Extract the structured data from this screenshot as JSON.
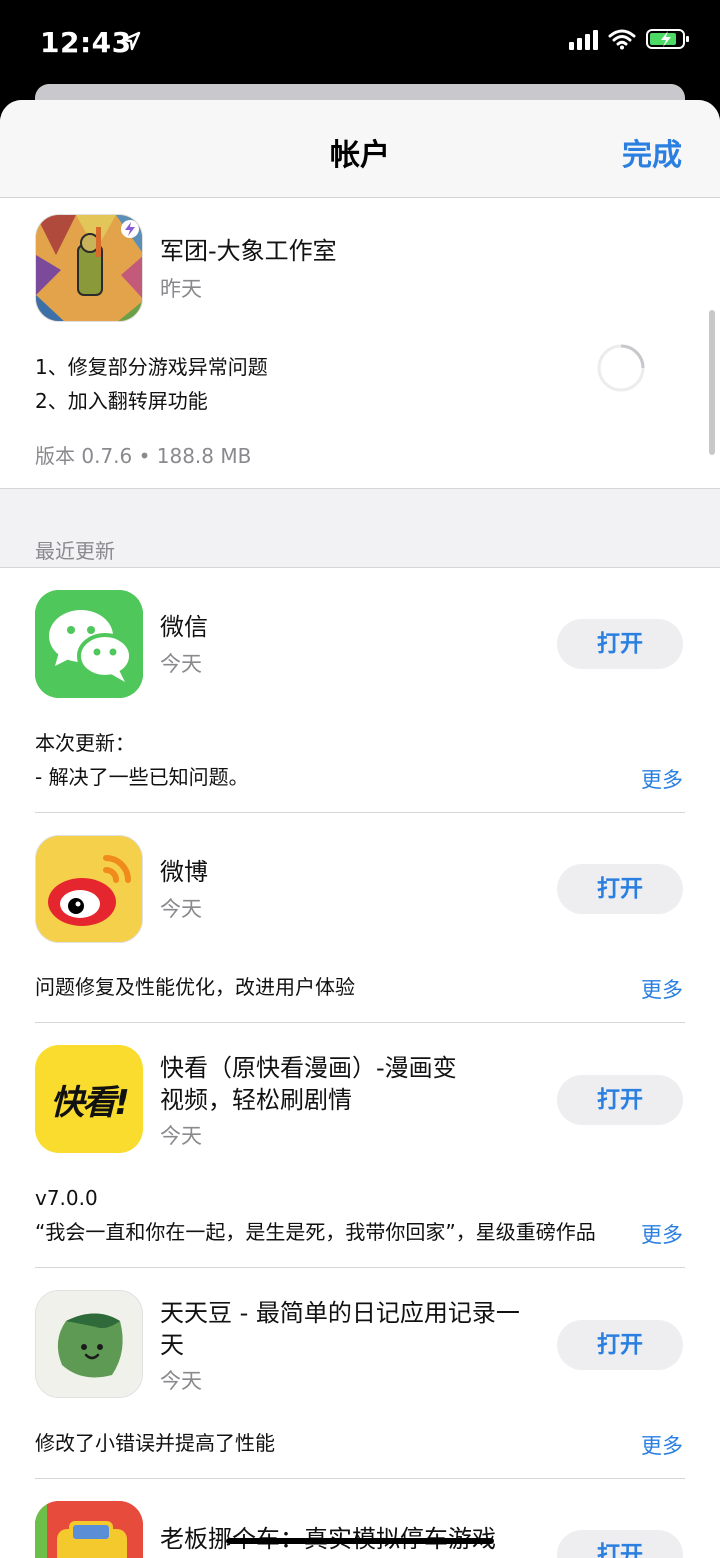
{
  "status": {
    "time": "12:43"
  },
  "header": {
    "title": "帐户",
    "done_label": "完成"
  },
  "pending": {
    "name": "军团-大象工作室",
    "date": "昨天",
    "notes": [
      "1、修复部分游戏异常问题",
      "2、加入翻转屏功能"
    ],
    "version": "版本 0.7.6 • 188.8 MB"
  },
  "section": {
    "title": "最近更新"
  },
  "apps": [
    {
      "name": "微信",
      "date": "今天",
      "open": "打开",
      "notes": [
        "本次更新：",
        "- 解决了一些已知问题。"
      ],
      "more": "更多"
    },
    {
      "name": "微博",
      "date": "今天",
      "open": "打开",
      "notes": [
        "问题修复及性能优化，改进用户体验"
      ],
      "more": "更多"
    },
    {
      "name_lines": [
        "快看（原快看漫画）-漫画变",
        "视频，轻松刷剧情"
      ],
      "date": "今天",
      "open": "打开",
      "notes": [
        "v7.0.0",
        "“我会一直和你在一起，是生是死，我带你回家”，星级重磅作品"
      ],
      "more": "更多",
      "icon_text": "快看!"
    },
    {
      "name_lines": [
        "天天豆 - 最简单的日记应用记录一",
        "天"
      ],
      "date": "今天",
      "open": "打开",
      "notes": [
        "修改了小错误并提高了性能"
      ],
      "more": "更多"
    },
    {
      "name": "老板挪个车：真实模拟停车游戏",
      "open": "打开"
    }
  ],
  "colors": {
    "accent": "#2a7fe0",
    "wechat": "#4fc75a",
    "weibo_bg": "#f5d04a",
    "kuaikan": "#f9dc2e"
  }
}
